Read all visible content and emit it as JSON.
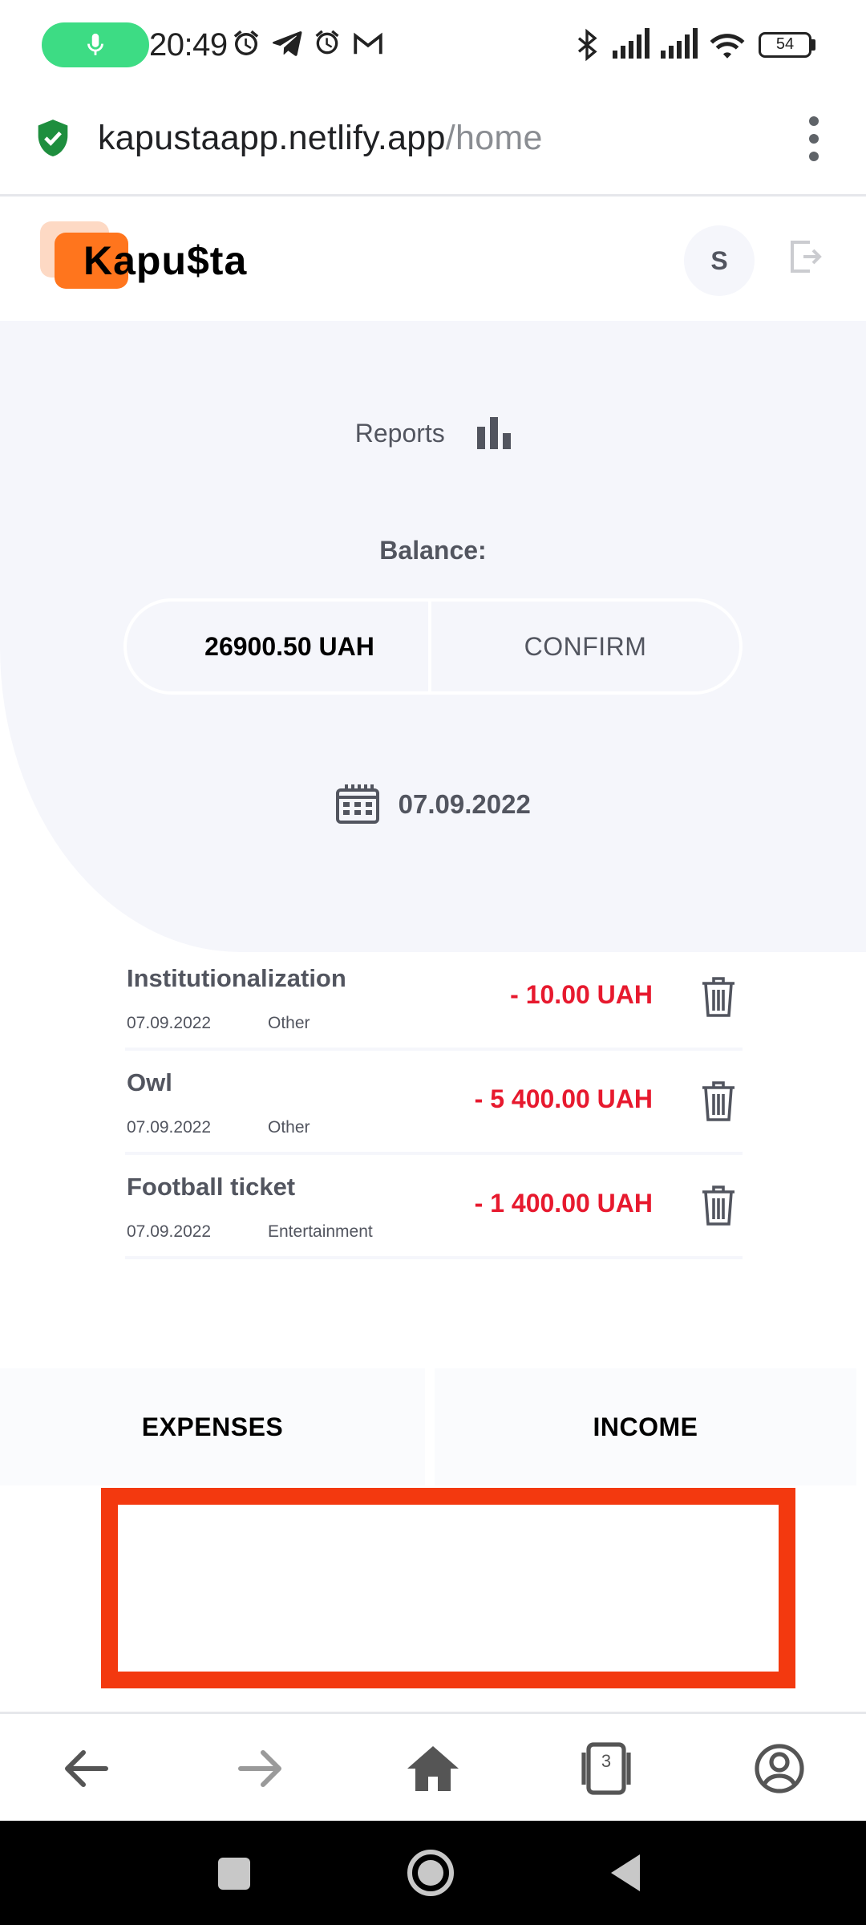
{
  "status_bar": {
    "time": "20:49",
    "battery": "54",
    "icons": [
      "mic-icon",
      "alarm-icon",
      "telegram-icon",
      "alarm-icon",
      "gmail-icon",
      "bluetooth-icon",
      "signal-icon",
      "signal-icon",
      "wifi-icon",
      "battery-icon"
    ]
  },
  "browser": {
    "url_domain": "kapustaapp.netlify.app",
    "url_path": "/home",
    "tabs_count": "3"
  },
  "header": {
    "logo_text": "Kapu$ta",
    "avatar_letter": "S"
  },
  "hero": {
    "reports_label": "Reports",
    "balance_label": "Balance:",
    "balance_value": "26900.50 UAH",
    "confirm_label": "CONFIRM",
    "date": "07.09.2022"
  },
  "transactions": [
    {
      "description": "Institutionalization",
      "date": "07.09.2022",
      "category": "Other",
      "amount": "- 10.00 UAH"
    },
    {
      "description": "Owl",
      "date": "07.09.2022",
      "category": "Other",
      "amount": "- 5 400.00 UAH"
    },
    {
      "description": "Football ticket",
      "date": "07.09.2022",
      "category": "Entertainment",
      "amount": "- 1 400.00 UAH"
    }
  ],
  "tabs": {
    "expenses": "EXPENSES",
    "income": "INCOME"
  },
  "colors": {
    "accent_orange": "#ff751d",
    "expense_red": "#e7192e",
    "hero_bg": "#f5f6fb",
    "highlight_box": "#f3390f"
  }
}
